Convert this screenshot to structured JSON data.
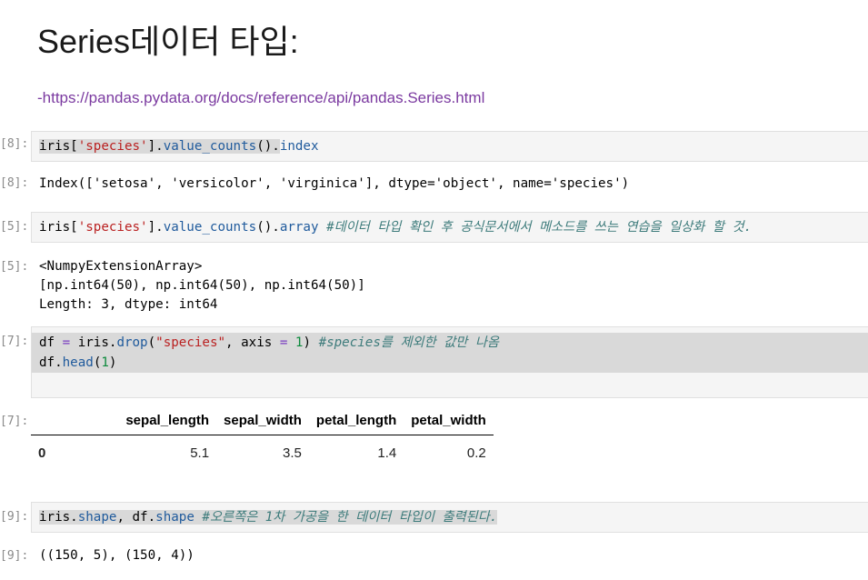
{
  "markdown": {
    "heading": "Series데이터 타입:",
    "link": "-https://pandas.pydata.org/docs/reference/api/pandas.Series.html"
  },
  "cells": {
    "c1": {
      "in_prompt": "[8]:",
      "code": {
        "t1": "iris",
        "t2": "[",
        "t3": "'species'",
        "t4": "].",
        "t5": "value_counts",
        "t6": "().",
        "t7": "index"
      },
      "out_prompt": "[8]:",
      "output": "Index(['setosa', 'versicolor', 'virginica'], dtype='object', name='species')"
    },
    "c2": {
      "in_prompt": "[5]:",
      "code": {
        "t1": "iris",
        "t2": "[",
        "t3": "'species'",
        "t4": "].",
        "t5": "value_counts",
        "t6": "().",
        "t7": "array",
        "t8": " #데이터 타입 확인 후 공식문서에서 메소드를 쓰는 연습을 일상화 할 것."
      },
      "out_prompt": "[5]:",
      "output": "<NumpyExtensionArray>\n[np.int64(50), np.int64(50), np.int64(50)]\nLength: 3, dtype: int64"
    },
    "c3": {
      "in_prompt": "[7]:",
      "code_line1": {
        "t1": "df ",
        "t2": "=",
        "t3": " iris",
        "t4": ".",
        "t5": "drop",
        "t6": "(",
        "t7": "\"species\"",
        "t8": ", axis ",
        "t9": "=",
        "t10": " ",
        "t11": "1",
        "t12": ") ",
        "t13": "#species를 제외한 값만 나옴"
      },
      "code_line2": {
        "t1": "df",
        "t2": ".",
        "t3": "head",
        "t4": "(",
        "t5": "1",
        "t6": ")"
      },
      "out_prompt": "[7]:",
      "table": {
        "columns": [
          "sepal_length",
          "sepal_width",
          "petal_length",
          "petal_width"
        ],
        "rows": [
          {
            "index": "0",
            "values": [
              "5.1",
              "3.5",
              "1.4",
              "0.2"
            ]
          }
        ]
      }
    },
    "c4": {
      "in_prompt": "[9]:",
      "code": {
        "t1": "iris",
        "t2": ".",
        "t3": "shape",
        "t4": ", df",
        "t5": ".",
        "t6": "shape",
        "t7": " #오른쪽은 1차 가공을 한 데이터 타입이 출력된다."
      },
      "out_prompt": "[9]:",
      "output": "((150, 5), (150, 4))"
    }
  },
  "colors": {
    "string": "#ba2121",
    "attribute": "#1f5a9c",
    "comment": "#3d7b7b",
    "number": "#0c8a3c",
    "operator": "#7a3ec1",
    "link": "#7b3aa0"
  }
}
